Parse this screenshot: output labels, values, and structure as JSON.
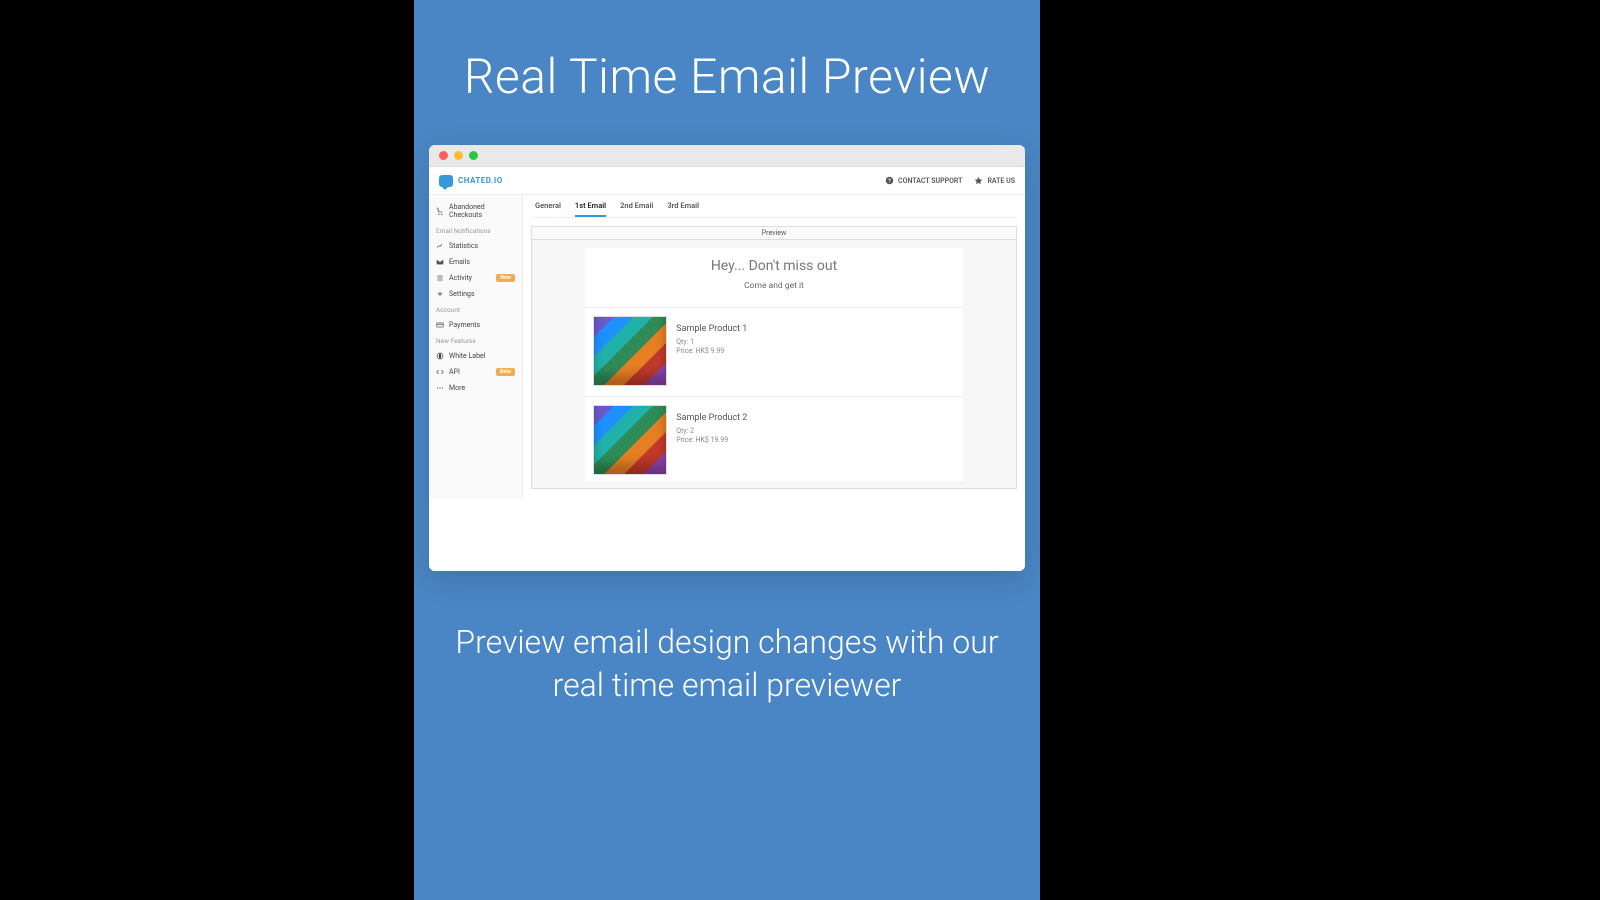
{
  "promo": {
    "title": "Real Time Email Preview",
    "subtitle": "Preview email design changes with our real time email previewer"
  },
  "brand": {
    "name": "CHATED.IO"
  },
  "topnav": {
    "contact": "CONTACT SUPPORT",
    "rate": "RATE US"
  },
  "sidebar": {
    "abandoned": "Abandoned Checkouts",
    "emailNotifications": "Email Notifications",
    "statistics": "Statistics",
    "emails": "Emails",
    "activity": "Activity",
    "activityBadge": "New",
    "settings": "Settings",
    "account": "Account",
    "payments": "Payments",
    "newFeatures": "New Features",
    "whitelabel": "White Label",
    "api": "API",
    "apiBadge": "Beta",
    "more": "More"
  },
  "tabs": {
    "general": "General",
    "first": "1st Email",
    "second": "2nd Email",
    "third": "3rd Email"
  },
  "preview": {
    "label": "Preview",
    "headline": "Hey... Don't miss out",
    "subheadline": "Come and get it"
  },
  "products": [
    {
      "name": "Sample Product 1",
      "qty": "Qty: 1",
      "price": "Price: HK$ 9.99"
    },
    {
      "name": "Sample Product 2",
      "qty": "Qty: 2",
      "price": "Price: HK$ 19.99"
    }
  ]
}
